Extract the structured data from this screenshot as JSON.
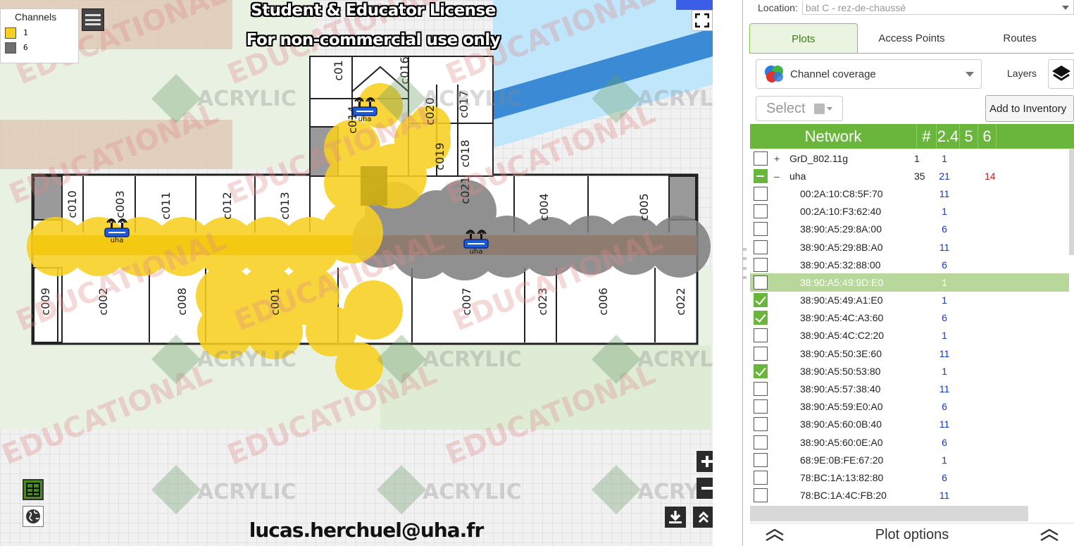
{
  "map": {
    "banner_line1": "Student & Educator License",
    "banner_line2": "For non-commercial use only",
    "footer_email": "lucas.herchuel@uha.fr",
    "watermark_educational": "EDUCATIONAL",
    "watermark_acrylic": "ACRYLIC",
    "legend": {
      "title": "Channels",
      "items": [
        {
          "label": "1",
          "color": "#f8d020"
        },
        {
          "label": "6",
          "color": "#6e6e6e"
        }
      ]
    },
    "access_points": [
      {
        "label": "uha"
      },
      {
        "label": "uha"
      },
      {
        "label": "uha"
      }
    ],
    "rooms": [
      "c010",
      "c003",
      "c011",
      "c012",
      "c013",
      "c01",
      "c016",
      "c014",
      "c020",
      "c017",
      "c019",
      "c018",
      "c021",
      "c004",
      "c005",
      "c009",
      "c002",
      "c008",
      "c001",
      "c007",
      "c023",
      "c006",
      "c022"
    ],
    "icons": [
      "fullscreen-icon",
      "zoom-in-icon",
      "zoom-out-icon",
      "download-icon",
      "collapse-up-icon",
      "layout-icon",
      "globe-icon"
    ]
  },
  "panel": {
    "location_label": "Location:",
    "location_value": "bat C - rez-de-chaussé",
    "tabs": [
      {
        "label": "Plots",
        "active": true
      },
      {
        "label": "Access Points",
        "active": false
      },
      {
        "label": "Routes",
        "active": false
      }
    ],
    "coverage_select": "Channel coverage",
    "layers_label": "Layers",
    "select_label": "Select",
    "add_inventory_label": "Add to Inventory",
    "columns": {
      "network": "Network",
      "count": "#",
      "band24": "2.4",
      "band5": "5",
      "band6": "6"
    },
    "networks": [
      {
        "type": "group",
        "expander": "+",
        "name": "GrD_802.11g",
        "count": "1",
        "band24": "1",
        "band5": "",
        "checked": "empty"
      },
      {
        "type": "group",
        "expander": "–",
        "name": "uha",
        "count": "35",
        "band24": "21",
        "band5": "14",
        "checked": "partial"
      },
      {
        "type": "bssid",
        "name": "00:2A:10:C8:5F:70",
        "band24": "11",
        "checked": "empty"
      },
      {
        "type": "bssid",
        "name": "00:2A:10:F3:62:40",
        "band24": "1",
        "checked": "empty"
      },
      {
        "type": "bssid",
        "name": "38:90:A5:29:8A:00",
        "band24": "6",
        "checked": "empty"
      },
      {
        "type": "bssid",
        "name": "38:90:A5:29:8B:A0",
        "band24": "11",
        "checked": "empty"
      },
      {
        "type": "bssid",
        "name": "38:90:A5:32:88:00",
        "band24": "6",
        "checked": "empty"
      },
      {
        "type": "bssid",
        "name": "38:90:A5:49:9D:E0",
        "band24": "1",
        "checked": "empty",
        "selected": true
      },
      {
        "type": "bssid",
        "name": "38:90:A5:49:A1:E0",
        "band24": "1",
        "checked": "checked"
      },
      {
        "type": "bssid",
        "name": "38:90:A5:4C:A3:60",
        "band24": "6",
        "checked": "checked"
      },
      {
        "type": "bssid",
        "name": "38:90:A5:4C:C2:20",
        "band24": "1",
        "checked": "empty"
      },
      {
        "type": "bssid",
        "name": "38:90:A5:50:3E:60",
        "band24": "11",
        "checked": "empty"
      },
      {
        "type": "bssid",
        "name": "38:90:A5:50:53:80",
        "band24": "1",
        "checked": "checked"
      },
      {
        "type": "bssid",
        "name": "38:90:A5:57:38:40",
        "band24": "11",
        "checked": "empty"
      },
      {
        "type": "bssid",
        "name": "38:90:A5:59:E0:A0",
        "band24": "6",
        "checked": "empty"
      },
      {
        "type": "bssid",
        "name": "38:90:A5:60:0B:40",
        "band24": "11",
        "checked": "empty"
      },
      {
        "type": "bssid",
        "name": "38:90:A5:60:0E:A0",
        "band24": "6",
        "checked": "empty"
      },
      {
        "type": "bssid",
        "name": "68:9E:0B:FE:67:20",
        "band24": "1",
        "checked": "empty"
      },
      {
        "type": "bssid",
        "name": "78:BC:1A:13:82:80",
        "band24": "6",
        "checked": "empty"
      },
      {
        "type": "bssid",
        "name": "78:BC:1A:4C:FB:20",
        "band24": "11",
        "checked": "empty"
      }
    ],
    "plot_options_label": "Plot options",
    "colors": {
      "accent": "#6ab63d",
      "selected_row": "#b7d79b",
      "band24": "#1538c8",
      "band5": "#c41e1e"
    }
  }
}
